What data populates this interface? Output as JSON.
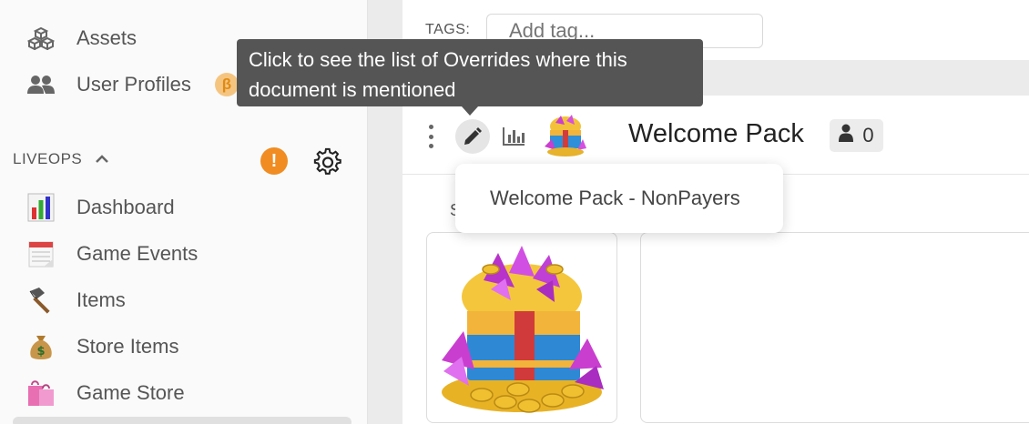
{
  "sidebar": {
    "items_top": [
      {
        "label": "Assets",
        "icon": "cubes-icon"
      },
      {
        "label": "User Profiles",
        "icon": "users-icon",
        "badge": "β"
      }
    ],
    "section": {
      "label": "LIVEOPS",
      "warning": "!"
    },
    "items": [
      {
        "label": "Dashboard",
        "icon": "bar-chart-icon"
      },
      {
        "label": "Game Events",
        "icon": "calendar-icon"
      },
      {
        "label": "Items",
        "icon": "hammer-icon"
      },
      {
        "label": "Store Items",
        "icon": "money-bag-icon"
      },
      {
        "label": "Game Store",
        "icon": "shopping-bags-icon"
      }
    ]
  },
  "tags": {
    "label": "TAGS:",
    "placeholder": "Add tag..."
  },
  "document": {
    "title": "Welcome Pack",
    "mention_count": "0",
    "section_letter": "S"
  },
  "tooltip": {
    "text": "Click to see the list of Overrides where this document is mentioned"
  },
  "dropdown": {
    "items": [
      "Welcome Pack - NonPayers"
    ]
  },
  "colors": {
    "accent_orange": "#f08c22",
    "beta_bg": "#f5c580",
    "tooltip_bg": "#555555"
  }
}
